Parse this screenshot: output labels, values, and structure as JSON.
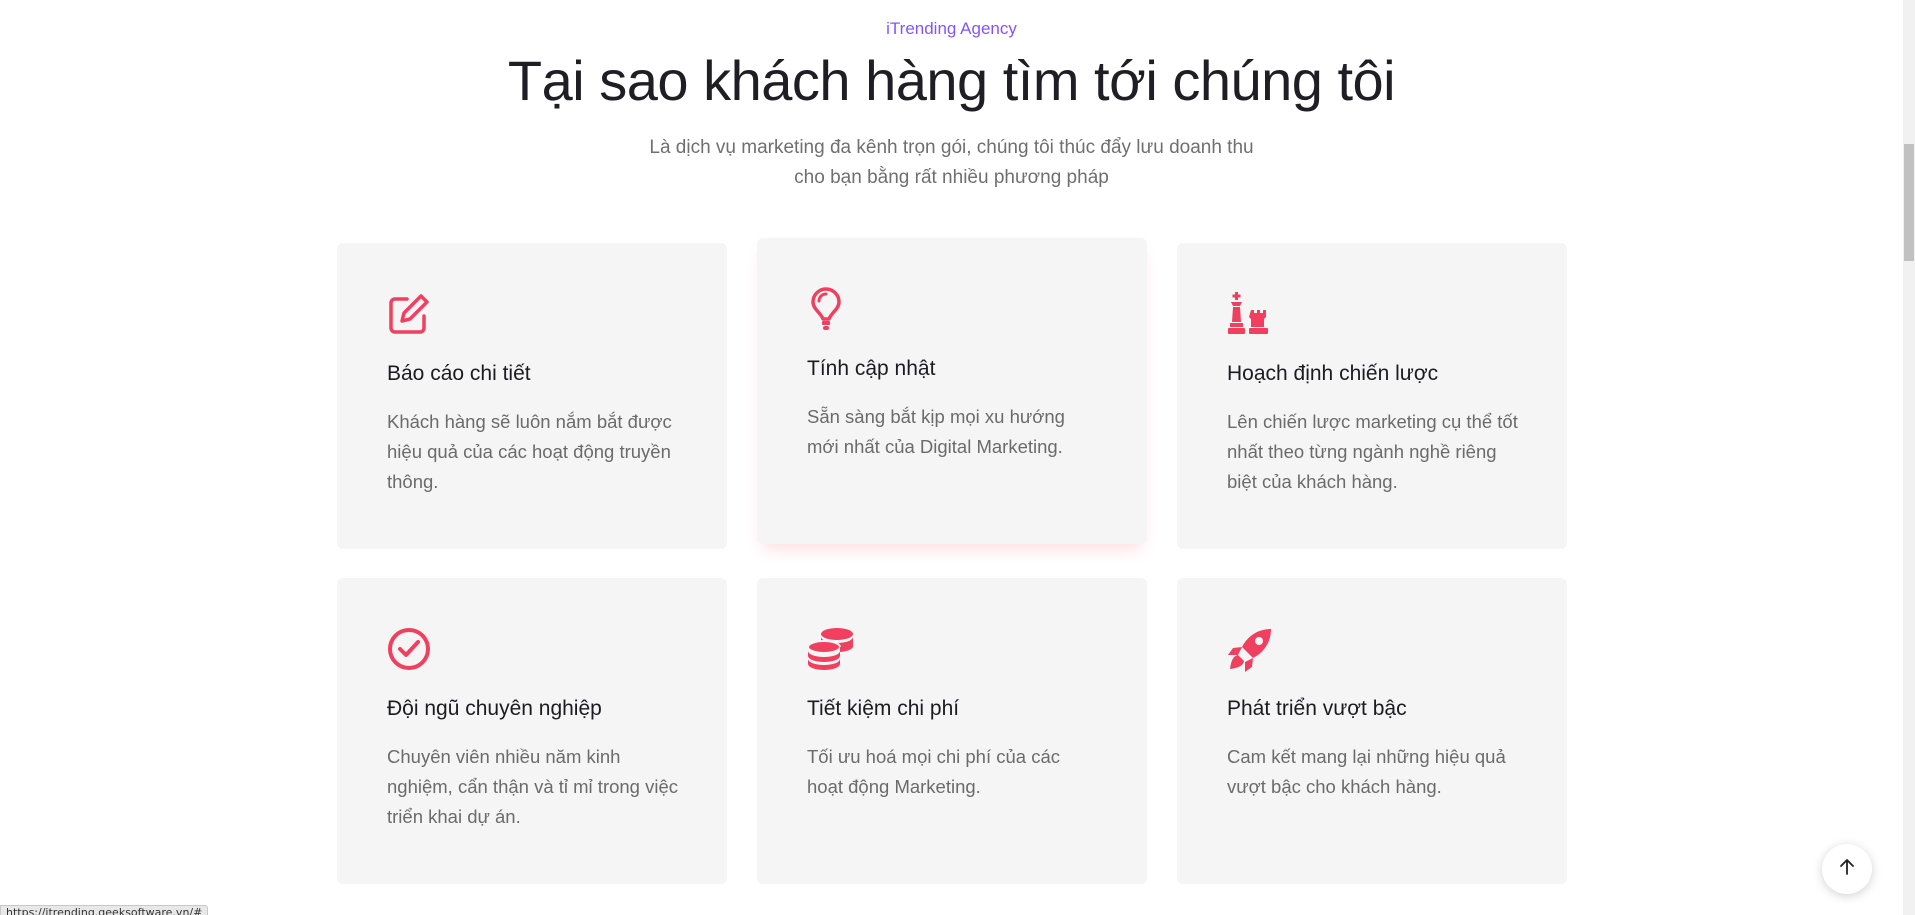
{
  "section": {
    "eyebrow": "iTrending Agency",
    "title": "Tại sao khách hàng tìm tới chúng tôi",
    "subtitle_lines": [
      "Là dịch vụ marketing đa kênh trọn gói, chúng tôi thúc đẩy lưu doanh thu",
      "cho bạn bằng rất nhiều phương pháp"
    ]
  },
  "features": [
    {
      "icon": "edit-icon",
      "title": "Báo cáo chi tiết",
      "text": "Khách hàng sẽ luôn nắm bắt được hiệu quả của các hoạt động truyền thông."
    },
    {
      "icon": "lightbulb-icon",
      "title": "Tính cập nhật",
      "text": "Sẵn sàng bắt kịp mọi xu hướng mới nhất của Digital Marketing."
    },
    {
      "icon": "chess-icon",
      "title": "Hoạch định chiến lược",
      "text": "Lên chiến lược marketing cụ thể tốt nhất theo từng ngành nghề riêng biệt của khách hàng."
    },
    {
      "icon": "check-circle-icon",
      "title": "Đội ngũ chuyên nghiệp",
      "text": "Chuyên viên nhiều năm kinh nghiệm, cẩn thận và tỉ mỉ trong việc triển khai dự án."
    },
    {
      "icon": "coins-icon",
      "title": "Tiết kiệm chi phí",
      "text": "Tối ưu hoá mọi chi phí của các hoạt động Marketing."
    },
    {
      "icon": "rocket-icon",
      "title": "Phát triển vượt bậc",
      "text": "Cam kết mang lại những hiệu quả vượt bậc cho khách hàng."
    }
  ],
  "status_bar": {
    "url": "https://itrending.geeksoftware.vn/#"
  },
  "colors": {
    "accent": "#f0405f",
    "card_bg": "#f5f5f5",
    "title": "#1e1e24",
    "body_text": "#6b6b6b"
  }
}
